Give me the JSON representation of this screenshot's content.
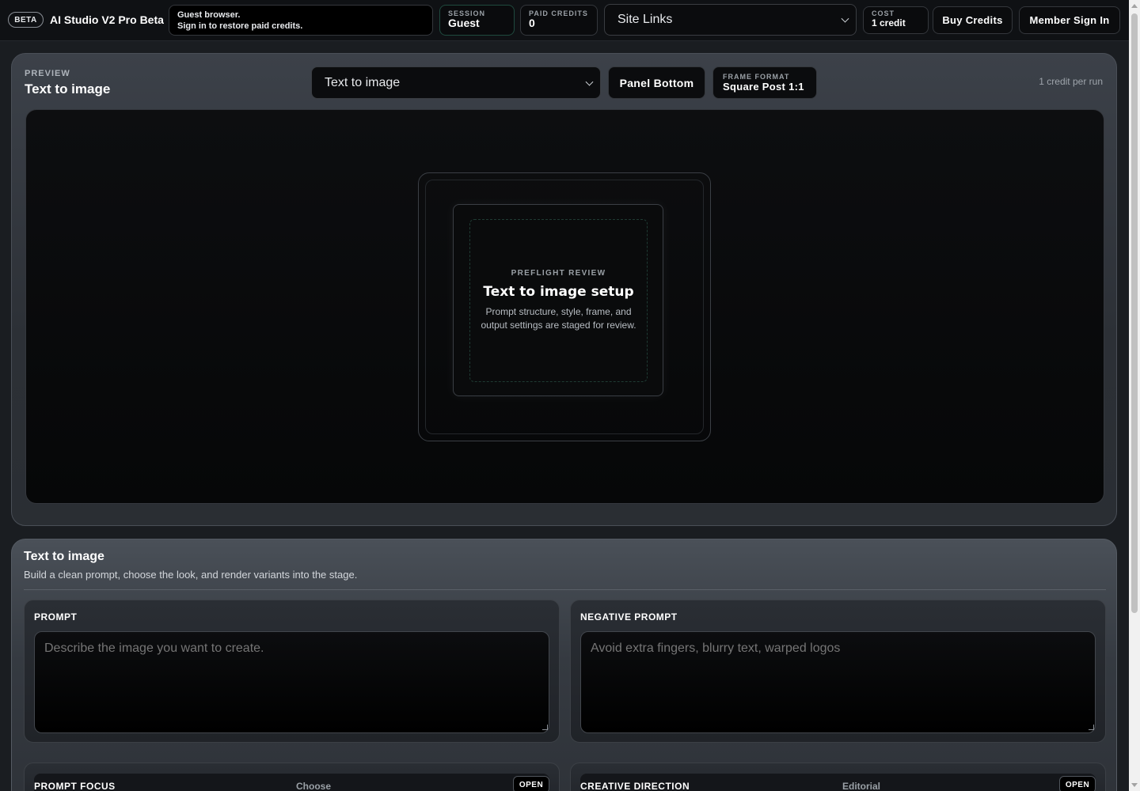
{
  "header": {
    "beta_badge": "BETA",
    "app_title": "AI Studio V2 Pro Beta",
    "guest_line1": "Guest browser.",
    "guest_line2": "Sign in to restore paid credits.",
    "session_label": "SESSION",
    "session_value": "Guest",
    "paid_label": "PAID CREDITS",
    "paid_value": "0",
    "site_links": "Site Links",
    "cost_label": "COST",
    "cost_value": "1 credit",
    "buy_credits": "Buy Credits",
    "member_sign_in": "Member Sign In"
  },
  "preview": {
    "eyebrow": "PREVIEW",
    "title": "Text to image",
    "mode_select": "Text to image",
    "panel_button": "Panel Bottom",
    "frame_format_label": "FRAME FORMAT",
    "frame_format_value": "Square Post 1:1",
    "credit_note": "1 credit per run",
    "card": {
      "eyebrow": "PREFLIGHT REVIEW",
      "title": "Text to image setup",
      "description": "Prompt structure, style, frame, and output settings are staged for review."
    }
  },
  "editor": {
    "title": "Text to image",
    "subtitle": "Build a clean prompt, choose the look, and render variants into the stage.",
    "prompt_label": "PROMPT",
    "prompt_placeholder": "Describe the image you want to create.",
    "negative_label": "NEGATIVE PROMPT",
    "negative_placeholder": "Avoid extra fingers, blurry text, warped logos",
    "options": [
      {
        "label": "PROMPT FOCUS",
        "value": "Choose",
        "button": "OPEN"
      },
      {
        "label": "CREATIVE DIRECTION",
        "value": "Editorial",
        "button": "OPEN"
      }
    ]
  }
}
